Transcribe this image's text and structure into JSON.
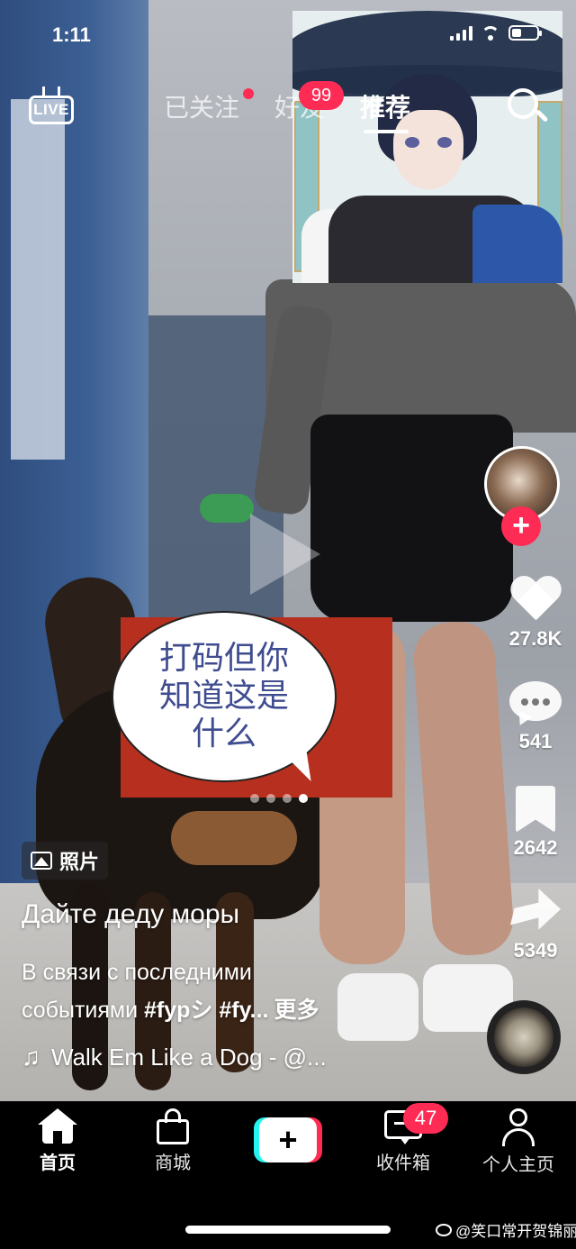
{
  "status_bar": {
    "time": "1:11"
  },
  "top_nav": {
    "live_label": "LIVE",
    "tabs": [
      {
        "label": "已关注",
        "has_dot": true
      },
      {
        "label": "好友",
        "badge": "99"
      },
      {
        "label": "推荐",
        "active": true
      }
    ],
    "search_icon": "search-icon"
  },
  "post": {
    "sticker_text": "打码但你知道这是什么",
    "type_badge": "照片",
    "title": "Дайте деду моры",
    "description_line1": "В связи с последними",
    "description_line2_text": "событиями ",
    "hashtag1": "#fypシ",
    "hashtag2": "#fy...",
    "more": "更多",
    "music": "Walk Em Like a Dog - @...",
    "carousel": {
      "total": 4,
      "active_index": 3
    }
  },
  "actions": {
    "likes": "27.8K",
    "comments": "541",
    "saves": "2642",
    "shares": "5349"
  },
  "bottom_nav": {
    "items": [
      {
        "label": "首页",
        "icon": "home-icon",
        "active": true
      },
      {
        "label": "商城",
        "icon": "shopping-bag-icon"
      },
      {
        "label": "",
        "icon": "create-plus-icon"
      },
      {
        "label": "收件箱",
        "icon": "inbox-icon",
        "badge": "47"
      },
      {
        "label": "个人主页",
        "icon": "profile-icon"
      }
    ]
  },
  "watermark": "@笑口常开贺锦丽",
  "colors": {
    "accent": "#fe2c55",
    "cyan": "#25f4ee",
    "sticker_red": "#b7301f",
    "sticker_text": "#3f4c8f"
  }
}
